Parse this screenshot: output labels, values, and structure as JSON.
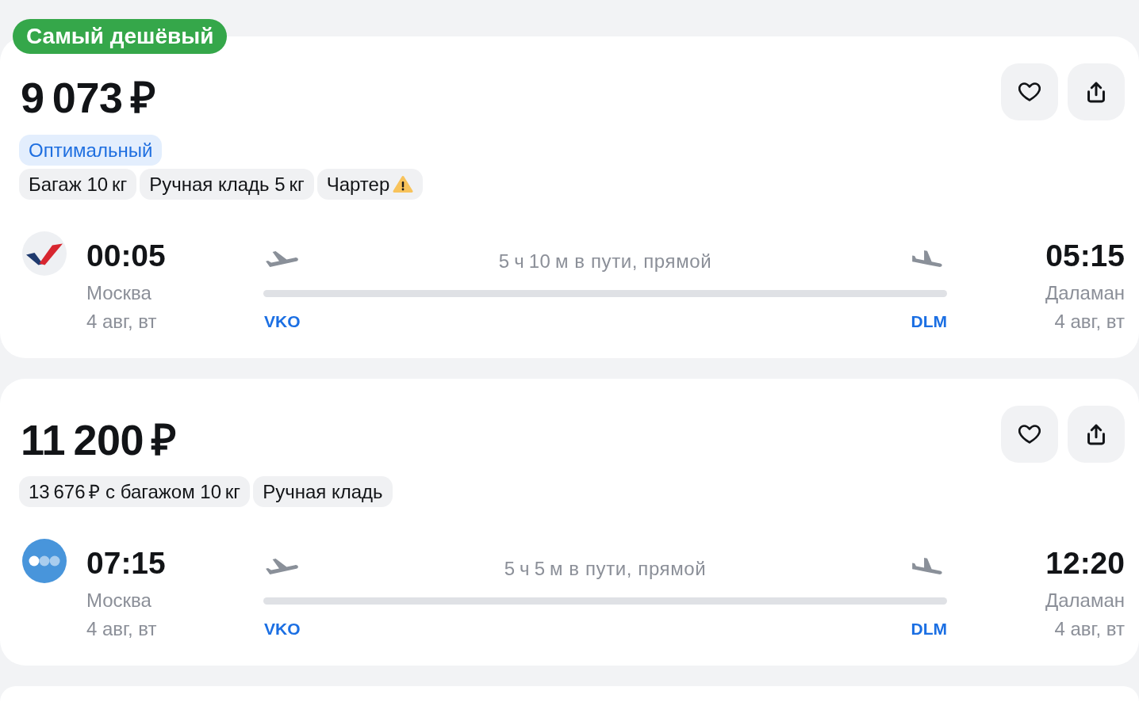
{
  "results": [
    {
      "badge": "Самый дешёвый",
      "price": "9 073 ₽",
      "favorited": false,
      "rating_tag": "Оптимальный",
      "tags": [
        {
          "text": "Багаж 10 кг",
          "warning": false
        },
        {
          "text": "Ручная кладь 5 кг",
          "warning": false
        },
        {
          "text": "Чартер",
          "warning": true
        }
      ],
      "flight": {
        "airline_logo": {
          "kind": "swoosh"
        },
        "departure": {
          "time": "00:05",
          "city": "Москва",
          "date": "4 авг, вт",
          "airport": "VKO"
        },
        "duration": "5 ч 10 м в пути, прямой",
        "arrival": {
          "time": "05:15",
          "city": "Даламан",
          "date": "4 авг, вт",
          "airport": "DLM"
        }
      }
    },
    {
      "price": "11 200 ₽",
      "favorited": false,
      "tags": [
        {
          "text": "13 676 ₽ с багажом 10 кг",
          "warning": false
        },
        {
          "text": "Ручная кладь",
          "warning": false
        }
      ],
      "flight": {
        "airline_logo": {
          "kind": "dots"
        },
        "departure": {
          "time": "07:15",
          "city": "Москва",
          "date": "4 авг, вт",
          "airport": "VKO"
        },
        "duration": "5 ч 5 м в пути, прямой",
        "arrival": {
          "time": "12:20",
          "city": "Даламан",
          "date": "4 авг, вт",
          "airport": "DLM"
        }
      }
    }
  ]
}
